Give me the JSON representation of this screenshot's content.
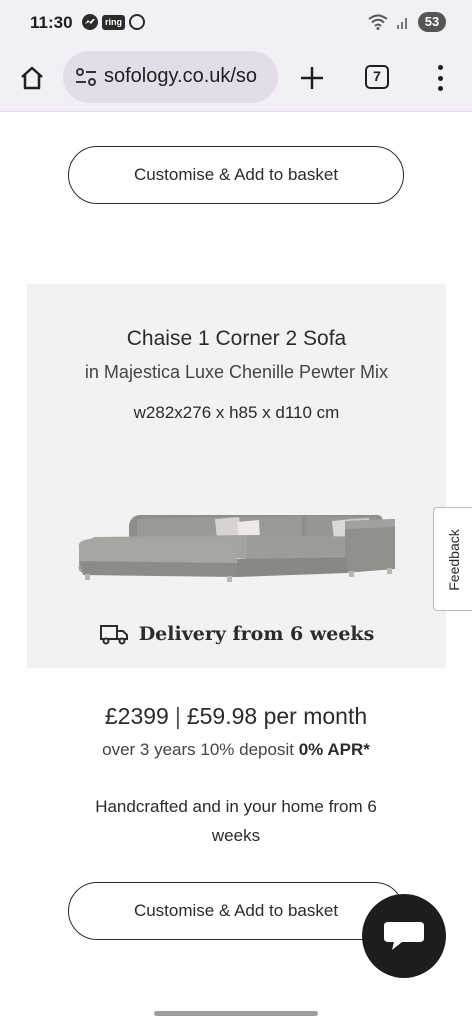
{
  "status_bar": {
    "time": "11:30",
    "ring_label": "ring",
    "battery": "53"
  },
  "browser": {
    "url": "sofology.co.uk/so",
    "tab_count": "7"
  },
  "buttons": {
    "customise_top": "Customise & Add to basket",
    "customise_bottom": "Customise & Add to basket"
  },
  "product": {
    "name": "Chaise 1 Corner 2 Sofa",
    "fabric": "in Majestica Luxe Chenille Pewter Mix",
    "dimensions": "w282x276 x h85 x d110 cm",
    "delivery": "Delivery from 6 weeks"
  },
  "feedback": {
    "label": "Feedback"
  },
  "pricing": {
    "price": "£2399",
    "separator": "|",
    "monthly": "£59.98 per month",
    "finance_prefix": "over 3 years 10% deposit",
    "apr": "0% APR*",
    "handcrafted": "Handcrafted and in your home from 6 weeks"
  },
  "colors": {
    "browser_bg": "#f3eff7",
    "card_bg": "#f2f2f2",
    "text": "#2b2b2b",
    "chat_button": "#1d1d1d"
  }
}
